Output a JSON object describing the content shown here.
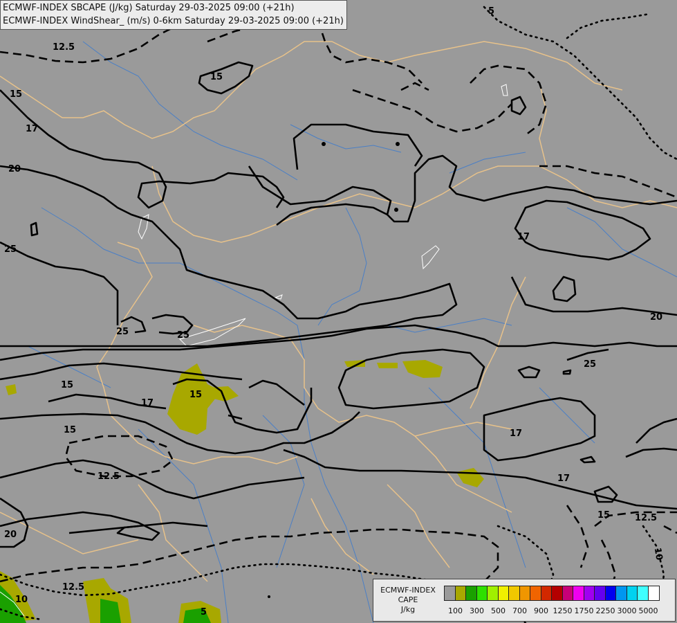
{
  "title": {
    "line1": "ECMWF-INDEX SBCAPE (J/kg) Saturday 29-03-2025 09:00 (+21h)",
    "line2": "ECMWF-INDEX WindShear_ (m/s) 0-6km Saturday 29-03-2025 09:00 (+21h)"
  },
  "legend": {
    "label_line1": "ECMWF-INDEX",
    "label_line2": "CAPE",
    "unit": "J/kg",
    "colors": [
      "#9a9a9a",
      "#a8a800",
      "#1aa000",
      "#2ee000",
      "#a0f000",
      "#f0f000",
      "#f0c800",
      "#f09600",
      "#f06400",
      "#d22800",
      "#b40000",
      "#c80078",
      "#f000f0",
      "#a000f0",
      "#6400f0",
      "#0000f0",
      "#0096f0",
      "#00d2f0",
      "#40ffff",
      "#ffffff"
    ],
    "ticks": [
      "100",
      "300",
      "500",
      "700",
      "900",
      "1250",
      "1750",
      "2250",
      "3000",
      "5000"
    ]
  },
  "contour_labels": {
    "l12_5a": "12.5",
    "l15a": "15",
    "l15b": "15",
    "l17a": "17",
    "l20a": "20",
    "l25a": "25",
    "l25b": "25",
    "l25c": "25",
    "l17b": "17",
    "l20b": "20",
    "l25d": "25",
    "l15c": "15",
    "l17c": "17",
    "l15d": "15",
    "l15e": "15",
    "l12_5b": "12.5",
    "l17d": "17",
    "l17e": "17",
    "l15f": "15",
    "l12_5c": "12.5",
    "l20c": "20",
    "l12_5d": "12.5",
    "l10a": "10",
    "l10b": "10",
    "l5a": "5",
    "l5b": "5"
  }
}
